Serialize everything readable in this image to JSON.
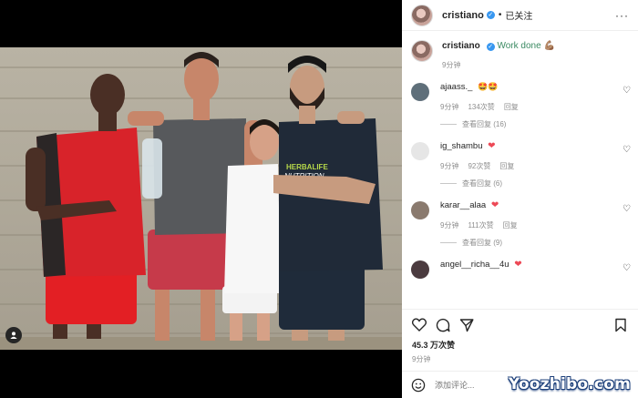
{
  "post": {
    "username": "cristiano",
    "follow_status": "已关注",
    "caption_text": "Work done",
    "caption_time": "9分钟",
    "likes": "45.3 万次赞",
    "post_time": "9分钟",
    "comment_placeholder": "添加评论..."
  },
  "comments": [
    {
      "username": "ajaass._",
      "text": "🤩🤩",
      "time": "9分钟",
      "likes": "134次赞",
      "reply": "回复",
      "view_replies": "查看回复 (16)",
      "avatar_color": "#5f6f7a"
    },
    {
      "username": "ig_shambu",
      "text": "❤",
      "time": "9分钟",
      "likes": "92次赞",
      "reply": "回复",
      "view_replies": "查看回复 (6)",
      "avatar_color": "#e6e6e6"
    },
    {
      "username": "karar__alaa",
      "text": "❤",
      "time": "9分钟",
      "likes": "111次赞",
      "reply": "回复",
      "view_replies": "查看回复 (9)",
      "avatar_color": "#8a7a6e"
    },
    {
      "username": "angel__richa__4u",
      "text": "❤",
      "time": "",
      "likes": "",
      "reply": "",
      "view_replies": "",
      "avatar_color": "#4b3b3f"
    }
  ],
  "watermark": "Yoozhibo.com",
  "icons": {
    "like": "heart-icon",
    "comment": "comment-icon",
    "share": "share-icon",
    "save": "bookmark-icon",
    "emoji": "smiley-icon",
    "more": "more-icon",
    "tag": "user-tag-icon"
  },
  "colors": {
    "verified": "#3897f0",
    "heart": "#ed4956",
    "muted": "#8e8e8e"
  }
}
